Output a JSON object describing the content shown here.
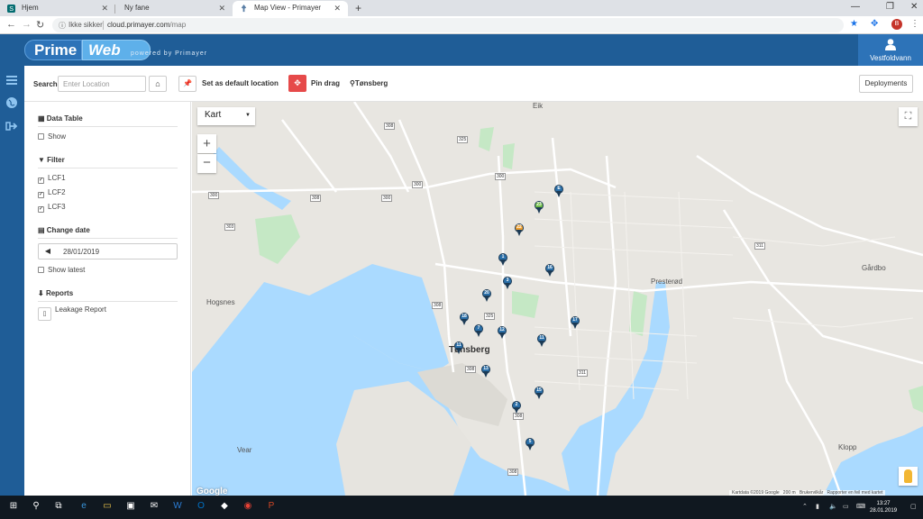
{
  "browser": {
    "tabs": [
      {
        "title": "Hjem"
      },
      {
        "title": "Ny fane"
      },
      {
        "title": "Map View - Primayer"
      }
    ],
    "address": {
      "security": "Ikke sikker",
      "host": "cloud.primayer.com",
      "path": "/map"
    },
    "profile_initial": "B"
  },
  "app": {
    "logo_prime": "Prime",
    "logo_web": "Web",
    "powered": "powered by Primayer",
    "user": "Vestfoldvann"
  },
  "toolbar": {
    "search_label": "Search",
    "search_placeholder": "Enter Location",
    "set_default": "Set as default location",
    "pin_drag": "Pin drag",
    "place": "Tønsberg",
    "deployments": "Deployments"
  },
  "panel": {
    "data_table": {
      "title": "Data Table",
      "show": "Show"
    },
    "filter": {
      "title": "Filter",
      "items": [
        "LCF1",
        "LCF2",
        "LCF3"
      ]
    },
    "change_date": {
      "title": "Change date",
      "date": "28/01/2019",
      "show_latest": "Show latest"
    },
    "reports": {
      "title": "Reports",
      "leakage": "Leakage Report"
    }
  },
  "map": {
    "type_selector": "Kart",
    "city": "Tønsberg",
    "places": [
      "Hogsnes",
      "Presterød",
      "Gårdbo",
      "Vear",
      "Klopp",
      "Eik"
    ],
    "roads": [
      "308",
      "325",
      "300",
      "300",
      "300",
      "300",
      "303",
      "311",
      "308",
      "308",
      "308",
      "311",
      "308",
      "308",
      "325"
    ],
    "attribution": [
      "Kartdata ©2019 Google",
      "200 m",
      "Brukervilkår",
      "Rapporter en feil med kartet"
    ],
    "google": "Google",
    "colors": {
      "marker_blue": "#2a6fa8",
      "marker_green": "#6fbe45",
      "marker_orange": "#f0a030",
      "water": "#aadaff",
      "park": "#c5e8c5"
    },
    "markers": [
      {
        "label": "E",
        "color": "blue"
      },
      {
        "label": "23",
        "color": "green"
      },
      {
        "label": "22",
        "color": "orange"
      },
      {
        "label": "1",
        "color": "blue"
      },
      {
        "label": "16",
        "color": "blue"
      },
      {
        "label": "3",
        "color": "blue"
      },
      {
        "label": "20",
        "color": "blue"
      },
      {
        "label": "18",
        "color": "blue"
      },
      {
        "label": "7",
        "color": "blue"
      },
      {
        "label": "12",
        "color": "blue"
      },
      {
        "label": "17",
        "color": "blue"
      },
      {
        "label": "11",
        "color": "blue"
      },
      {
        "label": "11",
        "color": "blue"
      },
      {
        "label": "13",
        "color": "blue"
      },
      {
        "label": "15",
        "color": "blue"
      },
      {
        "label": "2",
        "color": "blue"
      },
      {
        "label": "5",
        "color": "blue"
      }
    ]
  },
  "taskbar": {
    "time": "13:27",
    "date": "28.01.2019"
  }
}
